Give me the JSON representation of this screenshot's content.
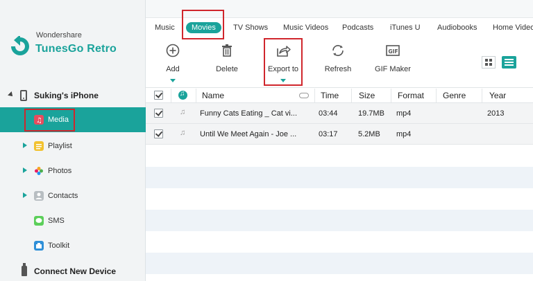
{
  "sidebar": {
    "brand": "Wondershare",
    "product": "TunesGo Retro",
    "device_name": "Suking's iPhone",
    "items": [
      {
        "label": "Media"
      },
      {
        "label": "Playlist"
      },
      {
        "label": "Photos"
      },
      {
        "label": "Contacts"
      },
      {
        "label": "SMS"
      },
      {
        "label": "Toolkit"
      }
    ],
    "connect_label": "Connect New Device"
  },
  "tabs": [
    "Music",
    "Movies",
    "TV Shows",
    "Music Videos",
    "Podcasts",
    "iTunes U",
    "Audiobooks",
    "Home Videos"
  ],
  "active_tab": "Movies",
  "toolbar": {
    "add": "Add",
    "delete": "Delete",
    "export": "Export to",
    "refresh": "Refresh",
    "gif": "GIF Maker"
  },
  "table": {
    "columns": {
      "name": "Name",
      "time": "Time",
      "size": "Size",
      "format": "Format",
      "genre": "Genre",
      "year": "Year"
    },
    "rows": [
      {
        "name": "Funny Cats Eating _ Cat vi...",
        "time": "03:44",
        "size": "19.7MB",
        "format": "mp4",
        "genre": "",
        "year": "2013"
      },
      {
        "name": "Until We Meet Again - Joe ...",
        "time": "03:17",
        "size": "5.2MB",
        "format": "mp4",
        "genre": "",
        "year": ""
      }
    ]
  },
  "colors": {
    "accent": "#1aa39b",
    "highlight_box": "#d0262c"
  }
}
